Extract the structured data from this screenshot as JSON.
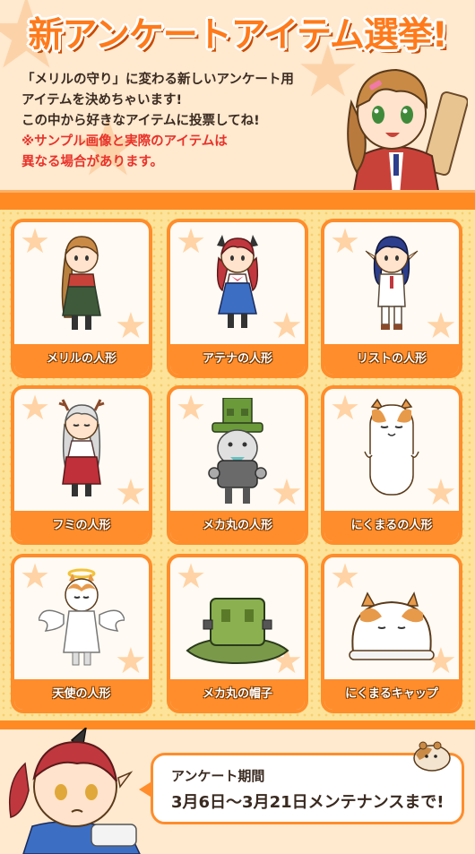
{
  "header": {
    "title": "新アンケートアイテム選挙!",
    "intro_line1": "「メリルの守り」に変わる新しいアンケート用",
    "intro_line2": "アイテムを決めちゃいます!",
    "intro_line3": "この中から好きなアイテムに投票してね!",
    "note_line1": "※サンプル画像と実際のアイテムは",
    "note_line2": "異なる場合があります。"
  },
  "items": [
    {
      "label": "メリルの人形",
      "icon": "meryl-doll-icon"
    },
    {
      "label": "アテナの人形",
      "icon": "athena-doll-icon"
    },
    {
      "label": "リストの人形",
      "icon": "rist-doll-icon"
    },
    {
      "label": "フミの人形",
      "icon": "fumi-doll-icon"
    },
    {
      "label": "メカ丸の人形",
      "icon": "mekamaru-doll-icon"
    },
    {
      "label": "にくまるの人形",
      "icon": "nikumaru-doll-icon"
    },
    {
      "label": "天使の人形",
      "icon": "angel-doll-icon"
    },
    {
      "label": "メカ丸の帽子",
      "icon": "mekamaru-hat-icon"
    },
    {
      "label": "にくまるキャップ",
      "icon": "nikumaru-cap-icon"
    }
  ],
  "footer": {
    "period_label": "アンケート期間",
    "period_value": "3月6日～3月21日メンテナンスまで!"
  },
  "colors": {
    "accent": "#ff8d2b",
    "title": "#ff7a1a",
    "note": "#e8322a",
    "grid_bg": "#fde39a"
  }
}
